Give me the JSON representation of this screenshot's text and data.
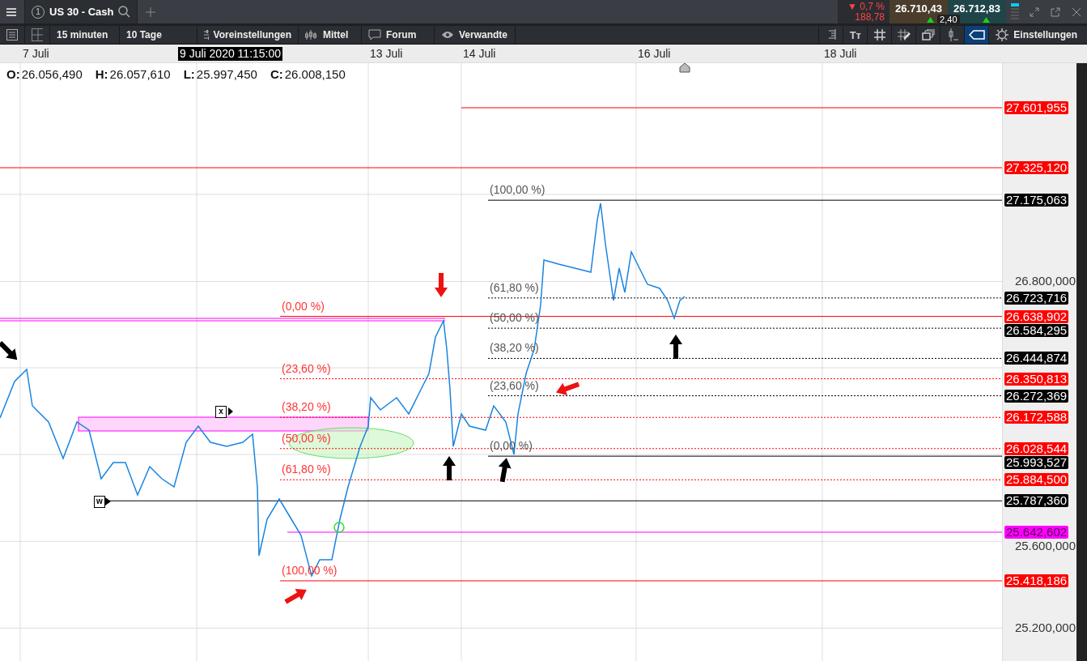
{
  "tab": {
    "number": "1",
    "title": "US 30 - Cash"
  },
  "quote": {
    "change_pct": "▼ 0,7 %",
    "change_abs": "188,78",
    "bid": "26.710,43",
    "ask": "26.712,83",
    "spread": "2,40"
  },
  "toolbar": {
    "interval": "15 minuten",
    "range": "10 Tage",
    "presets": "Voreinstellungen",
    "chart_type": "Mittel",
    "forum": "Forum",
    "related": "Verwandte",
    "text_size": "Tт",
    "settings": "Einstellungen",
    "tools": [
      {
        "kind": "legend",
        "selected": false
      },
      {
        "kind": "text",
        "selected": false
      },
      {
        "kind": "grid",
        "selected": false
      },
      {
        "kind": "draw",
        "selected": false
      },
      {
        "kind": "layers",
        "selected": false
      },
      {
        "kind": "candle",
        "selected": false
      },
      {
        "kind": "tag",
        "selected": true
      }
    ]
  },
  "date_axis": [
    {
      "label": "7 Juli",
      "selected": false
    },
    {
      "label": "9 Juli 2020 11:15:00",
      "selected": true
    },
    {
      "label": "13 Juli",
      "selected": false
    },
    {
      "label": "14 Juli",
      "selected": false
    },
    {
      "label": "16 Juli",
      "selected": false
    },
    {
      "label": "18 Juli",
      "selected": false
    }
  ],
  "ohlc": [
    {
      "label": "O:",
      "value": "26.056,490"
    },
    {
      "label": "H:",
      "value": "26.057,610"
    },
    {
      "label": "L:",
      "value": "25.997,450"
    },
    {
      "label": "C:",
      "value": "26.008,150"
    }
  ],
  "price_ticks": [
    "26.800,000",
    "25.600,000",
    "25.200,000"
  ],
  "levels": [
    {
      "price": "27.601,955",
      "color": "#ff0000",
      "kind": "solid"
    },
    {
      "price": "27.325,120",
      "color": "#ff0000",
      "kind": "solid"
    },
    {
      "price": "27.175,063",
      "color": "#000000",
      "kind": "solid",
      "label": "(100,00 %)"
    },
    {
      "price": "26.723,716",
      "color": "#000000",
      "kind": "dotted",
      "label": "(61,80 %)"
    },
    {
      "price": "26.638,902",
      "color": "#ff0000",
      "kind": "solid",
      "label": "(0,00 %)"
    },
    {
      "price": "26.584,295",
      "color": "#000000",
      "kind": "dotted",
      "label": "(50,00 %)"
    },
    {
      "price": "26.444,874",
      "color": "#000000",
      "kind": "dotted",
      "label": "(38,20 %)"
    },
    {
      "price": "26.350,813",
      "color": "#ff0000",
      "kind": "dotted",
      "label": "(23,60 %)"
    },
    {
      "price": "26.272,369",
      "color": "#000000",
      "kind": "dotted",
      "label": "(23,60 %)"
    },
    {
      "price": "26.172,588",
      "color": "#ff0000",
      "kind": "dotted",
      "label": "(38,20 %)"
    },
    {
      "price": "26.028,544",
      "color": "#ff0000",
      "kind": "dotted",
      "label": "(50,00 %)"
    },
    {
      "price": "25.993,527",
      "color": "#000000",
      "kind": "solid",
      "label": "(0,00 %)"
    },
    {
      "price": "25.884,500",
      "color": "#ff0000",
      "kind": "dotted",
      "label": "(61,80 %)"
    },
    {
      "price": "25.787,360",
      "color": "#000000",
      "kind": "solid"
    },
    {
      "price": "25.642,602",
      "color": "#ff00ff",
      "kind": "solid"
    },
    {
      "price": "25.418,186",
      "color": "#ff0000",
      "kind": "solid",
      "label": "(100,00 %)"
    }
  ],
  "markers": [
    {
      "text": "x"
    },
    {
      "text": "w"
    }
  ]
}
